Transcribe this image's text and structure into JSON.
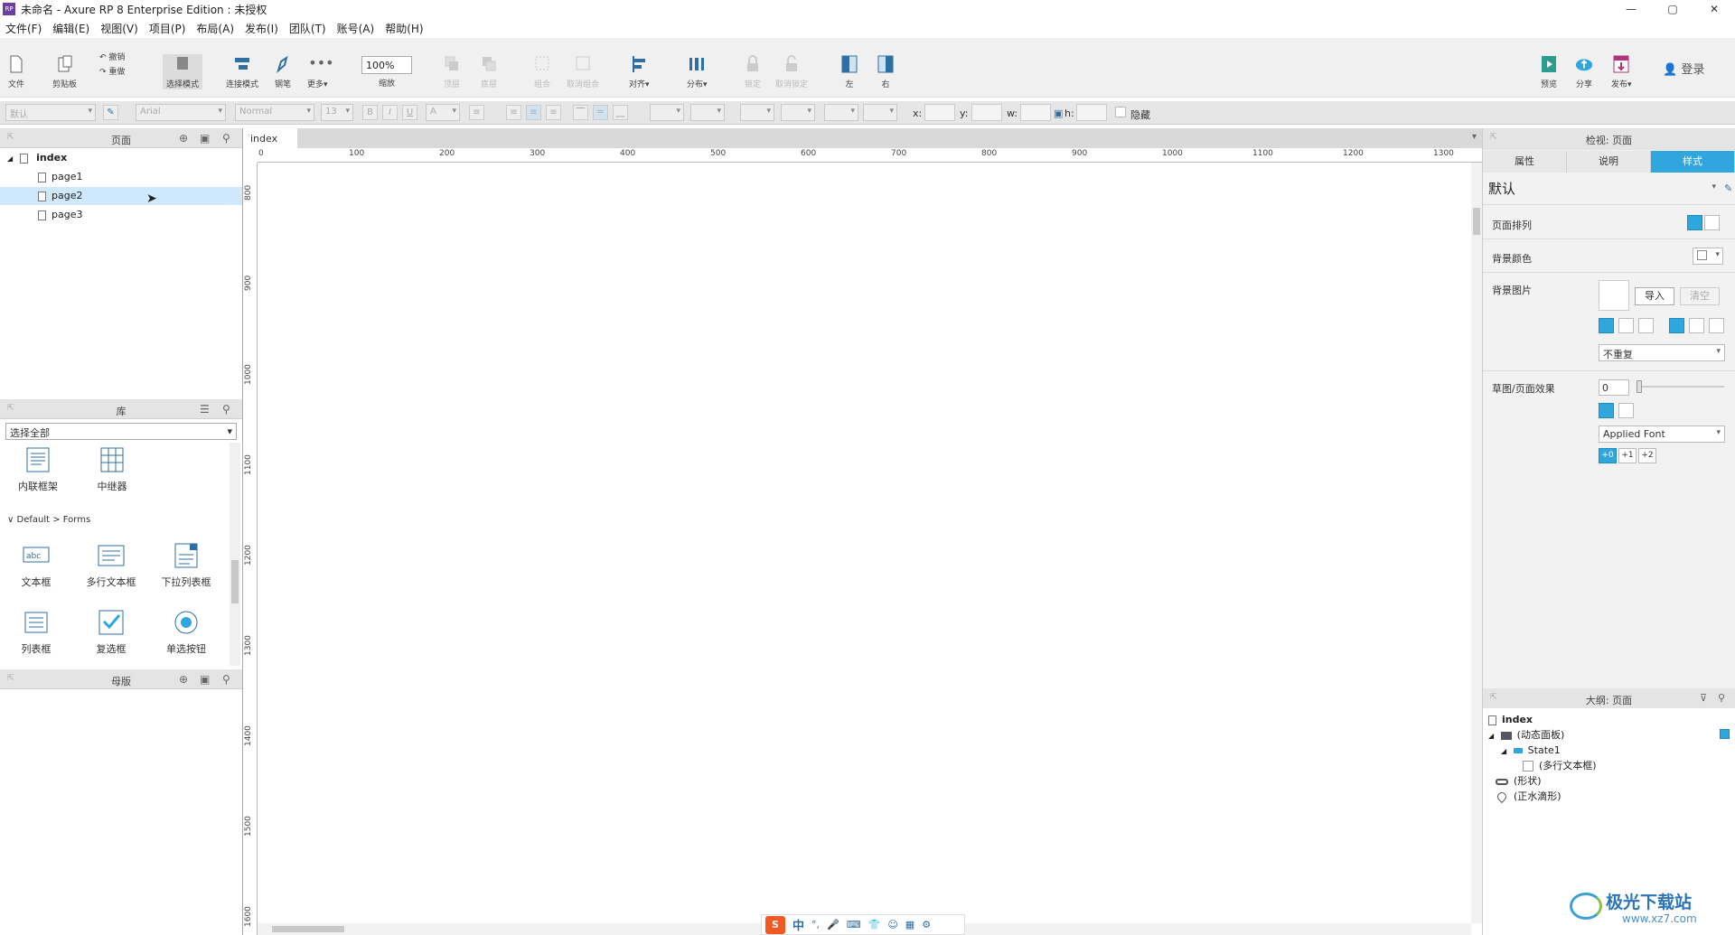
{
  "titlebar": {
    "title": "未命名 - Axure RP 8 Enterprise Edition : 未授权",
    "logo": "RP",
    "minimize": "—",
    "maximize": "▢",
    "close": "✕"
  },
  "menu": [
    "文件(F)",
    "编辑(E)",
    "视图(V)",
    "项目(P)",
    "布局(A)",
    "发布(I)",
    "团队(T)",
    "账号(A)",
    "帮助(H)"
  ],
  "toolbar": {
    "file": "文件",
    "clipboard": "剪贴板",
    "undo": "撤销",
    "redo": "重做",
    "select_mode": "选择模式",
    "connect_mode": "连接模式",
    "pen": "钢笔",
    "more": "更多▾",
    "zoom_value": "100%",
    "zoom_label": "缩放",
    "top": "顶层",
    "bottom": "底层",
    "group": "组合",
    "ungroup": "取消组合",
    "align": "对齐▾",
    "distribute": "分布▾",
    "lock": "锁定",
    "unlock": "取消锁定",
    "left": "左",
    "right": "右",
    "preview": "预览",
    "share": "分享",
    "publish": "发布▾",
    "login": "登录"
  },
  "formatbar": {
    "style": "默认",
    "font": "Arial",
    "weight": "Normal",
    "size": "13",
    "bold": "B",
    "italic": "I",
    "underline": "U",
    "font_color": "A",
    "x_label": "x:",
    "y_label": "y:",
    "w_label": "w:",
    "h_label": "h:",
    "hide_label": "隐藏"
  },
  "pages_pane": {
    "title": "页面",
    "root": "index",
    "pages": [
      "page1",
      "page2",
      "page3"
    ],
    "selected": "page2"
  },
  "library_pane": {
    "title": "库",
    "dropdown": "选择全部",
    "top_items": [
      "内联框架",
      "中继器"
    ],
    "section": "Default > Forms",
    "forms": [
      "文本框",
      "多行文本框",
      "下拉列表框",
      "列表框",
      "复选框",
      "单选按钮"
    ],
    "textbox_icon_text": "abc"
  },
  "masters_pane": {
    "title": "母版"
  },
  "canvas": {
    "tab": "index",
    "tab_close": "✕",
    "hruler_labels": [
      "0",
      "100",
      "200",
      "300",
      "400",
      "500",
      "600",
      "700",
      "800",
      "900",
      "1000",
      "1100",
      "1200",
      "1300"
    ],
    "vruler_labels": [
      "800",
      "900",
      "1000",
      "1100",
      "1200",
      "1300",
      "1400",
      "1500",
      "1600"
    ]
  },
  "inspector": {
    "title": "检视: 页面",
    "tabs": [
      "属性",
      "说明",
      "样式"
    ],
    "active_tab": "样式",
    "style_name": "默认",
    "page_align_label": "页面排列",
    "bg_color_label": "背景颜色",
    "bg_image_label": "背景图片",
    "import_btn": "导入",
    "clear_btn": "清空",
    "repeat_value": "不重复",
    "sketch_label": "草图/页面效果",
    "sketch_value": "0",
    "font_value": "Applied Font",
    "line_width_btns": [
      "+0",
      "+1",
      "+2"
    ]
  },
  "outline": {
    "title": "大纲: 页面",
    "root": "index",
    "items": [
      {
        "label": "(动态面板)",
        "level": 0
      },
      {
        "label": "State1",
        "level": 1
      },
      {
        "label": "(多行文本框)",
        "level": 2
      },
      {
        "label": "(形状)",
        "level": 0
      },
      {
        "label": "(正水滴形)",
        "level": 0
      }
    ]
  },
  "ime_bar": [
    "中",
    "°,"
  ],
  "watermark": {
    "text": "极光下载站",
    "url": "www.xz7.com"
  },
  "colors": {
    "accent": "#2fa6dd",
    "selection": "#cfe8fb",
    "toolbar_bg": "#f0f0f0"
  }
}
